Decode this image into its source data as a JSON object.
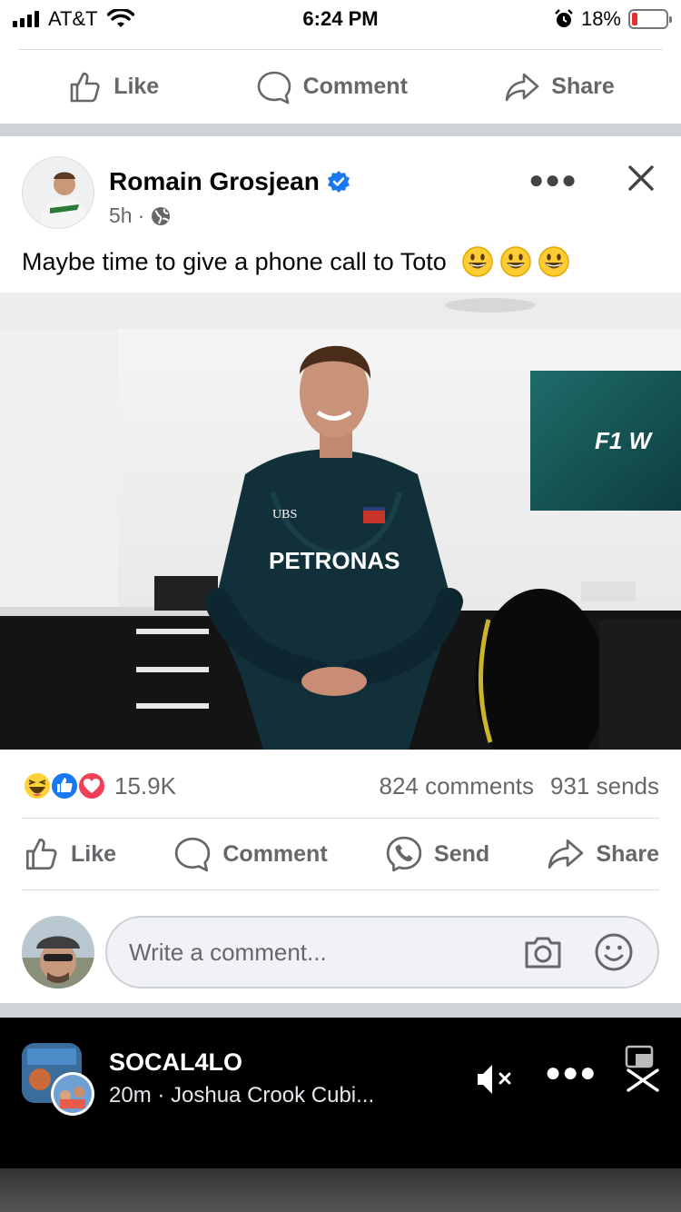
{
  "status_bar": {
    "carrier": "AT&T",
    "time": "6:24 PM",
    "battery": "18%",
    "battery_level": 0.18
  },
  "top_actions": [
    {
      "label": "Like",
      "icon": "thumbs-up-icon"
    },
    {
      "label": "Comment",
      "icon": "comment-icon"
    },
    {
      "label": "Share",
      "icon": "share-icon"
    }
  ],
  "post": {
    "author": "Romain Grosjean",
    "verified": true,
    "time": "5h",
    "privacy_icon": "globe-icon",
    "text": "Maybe time to give a phone call to Toto",
    "emoji_count": 3,
    "photo_text": {
      "sponsor": "PETRONAS",
      "ubs": "UBS",
      "screen": "F1 W"
    },
    "reactions": {
      "icons": [
        "haha-icon",
        "like-icon",
        "love-icon"
      ],
      "count": "15.9K",
      "comments": "824 comments",
      "sends": "931 sends"
    },
    "actions": [
      {
        "label": "Like",
        "icon": "thumbs-up-icon"
      },
      {
        "label": "Comment",
        "icon": "comment-icon"
      },
      {
        "label": "Send",
        "icon": "messenger-icon"
      },
      {
        "label": "Share",
        "icon": "share-icon"
      }
    ]
  },
  "comment_input": {
    "placeholder": "Write a comment..."
  },
  "next_post": {
    "author": "SOCAL4LO",
    "meta": "20m · Joshua Crook Cubi..."
  },
  "colors": {
    "verified": "#1877f2",
    "muted_text": "#65676b",
    "divider": "#cfd2d6"
  }
}
